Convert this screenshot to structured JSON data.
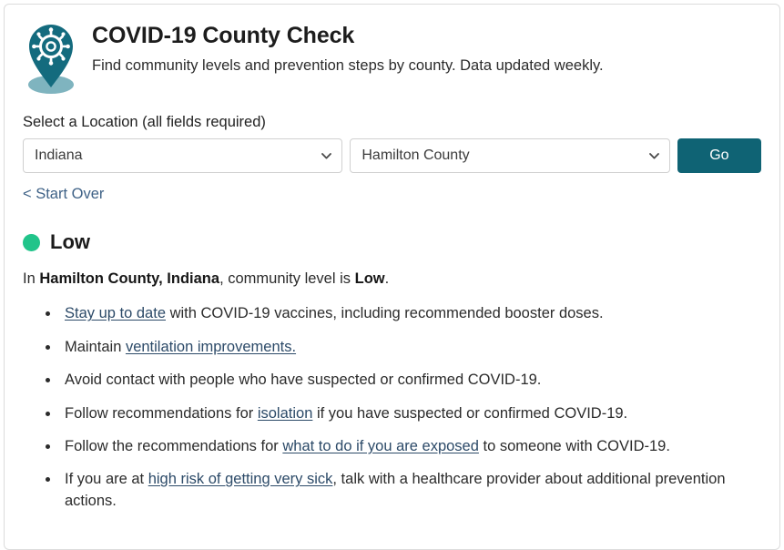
{
  "header": {
    "icon": "map-pin-virus-icon",
    "title": "COVID-19 County Check",
    "subtitle": "Find community levels and prevention steps by county. Data updated weekly."
  },
  "colors": {
    "brand_teal": "#0f6374",
    "pin_teal": "#146b7e",
    "pin_shadow": "#7fb4bf",
    "level_low_green": "#21c48a",
    "link_blue": "#2c4a68",
    "start_over_blue": "#3f6287",
    "card_border": "#dcdcdc"
  },
  "picker": {
    "label": "Select a Location (all fields required)",
    "state_select": {
      "value": "Indiana",
      "icon": "chevron-down-icon"
    },
    "county_select": {
      "value": "Hamilton County",
      "icon": "chevron-down-icon"
    },
    "go_label": "Go",
    "start_over_label": "< Start Over"
  },
  "result": {
    "level_label": "Low",
    "level_color": "#21c48a",
    "summary": {
      "prefix": "In ",
      "location": "Hamilton County, Indiana",
      "middle": ", community level is ",
      "level": "Low",
      "suffix": "."
    },
    "recommendations": [
      {
        "parts": [
          {
            "text": "Stay up to date",
            "link": true
          },
          {
            "text": " with COVID-19 vaccines, including recommended booster doses.",
            "link": false
          }
        ]
      },
      {
        "parts": [
          {
            "text": "Maintain ",
            "link": false
          },
          {
            "text": "ventilation improvements.",
            "link": true
          }
        ]
      },
      {
        "parts": [
          {
            "text": "Avoid contact with people who have suspected or confirmed COVID-19.",
            "link": false
          }
        ]
      },
      {
        "parts": [
          {
            "text": "Follow recommendations for ",
            "link": false
          },
          {
            "text": "isolation",
            "link": true
          },
          {
            "text": " if you have suspected or confirmed COVID-19.",
            "link": false
          }
        ]
      },
      {
        "parts": [
          {
            "text": "Follow the recommendations for ",
            "link": false
          },
          {
            "text": "what to do if you are exposed",
            "link": true
          },
          {
            "text": " to someone with COVID-19.",
            "link": false
          }
        ]
      },
      {
        "parts": [
          {
            "text": "If you are at ",
            "link": false
          },
          {
            "text": "high risk of getting very sick",
            "link": true
          },
          {
            "text": ", talk with a healthcare provider about additional prevention actions.",
            "link": false
          }
        ]
      }
    ]
  }
}
